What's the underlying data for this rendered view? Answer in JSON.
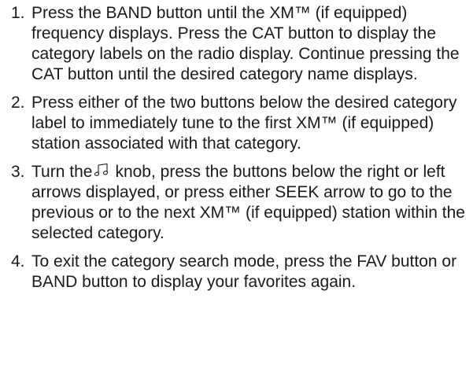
{
  "steps": [
    {
      "number": "1.",
      "text": "Press the BAND button until the XM™ (if equipped) frequency displays. Press the CAT button to display the category labels on the radio display. Continue pressing the CAT button until the desired category name displays."
    },
    {
      "number": "2.",
      "text": "Press either of the two buttons below the desired category label to immediately tune to the first XM™ (if equipped) station associated with that category."
    },
    {
      "number": "3.",
      "text_before": "Turn the",
      "icon": "music-note-knob-icon",
      "text_after": "knob, press the buttons below the right or left arrows displayed, or press either SEEK arrow to go to the previous or to the next XM™ (if equipped) station within the selected category."
    },
    {
      "number": "4.",
      "text": "To exit the category search mode, press the FAV button or BAND button to display your favorites again."
    }
  ]
}
